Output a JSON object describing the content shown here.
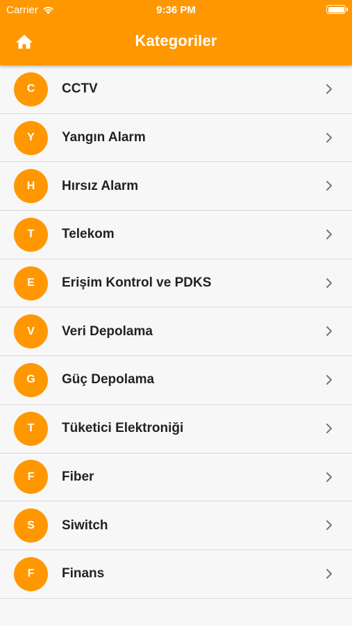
{
  "status_bar": {
    "carrier": "Carrier",
    "time": "9:36 PM",
    "icons": [
      "wifi-icon",
      "battery-icon"
    ]
  },
  "appbar": {
    "title": "Kategoriler",
    "home_icon": "home-icon",
    "color": "#ff9800"
  },
  "categories": [
    {
      "initial": "C",
      "label": "CCTV"
    },
    {
      "initial": "Y",
      "label": "Yangın Alarm"
    },
    {
      "initial": "H",
      "label": "Hırsız Alarm"
    },
    {
      "initial": "T",
      "label": "Telekom"
    },
    {
      "initial": "E",
      "label": "Erişim Kontrol ve PDKS"
    },
    {
      "initial": "V",
      "label": "Veri Depolama"
    },
    {
      "initial": "G",
      "label": "Güç Depolama"
    },
    {
      "initial": "T",
      "label": "Tüketici Elektroniği"
    },
    {
      "initial": "F",
      "label": "Fiber"
    },
    {
      "initial": "S",
      "label": "Siwitch"
    },
    {
      "initial": "F",
      "label": "Finans"
    }
  ],
  "row_icon": "chevron-right-icon",
  "accent_color": "#ff9800"
}
